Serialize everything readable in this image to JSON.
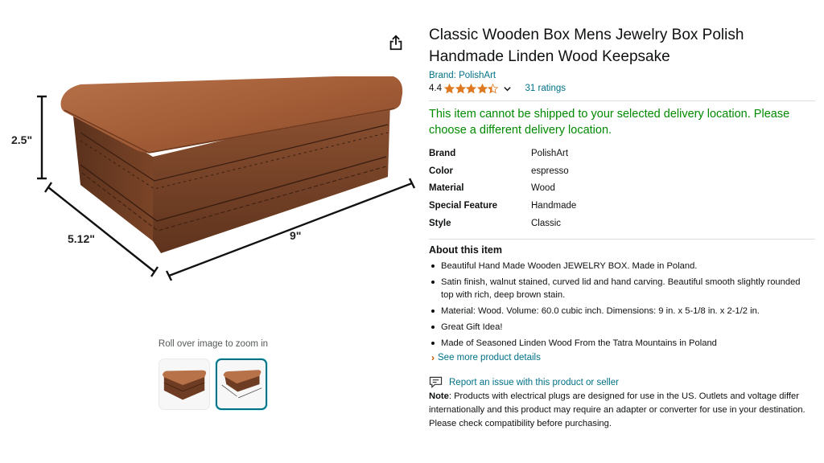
{
  "product": {
    "title": "Classic Wooden Box Mens Jewelry Box Polish Handmade Linden Wood Keepsake",
    "brand_link": "Brand: PolishArt",
    "rating": "4.4",
    "rating_fraction": 0.88,
    "ratings_count": "31 ratings",
    "shipping_message": "This item cannot be shipped to your selected delivery location. Please choose a different delivery location."
  },
  "image": {
    "dim_height": "2.5\"",
    "dim_depth": "5.12\"",
    "dim_width": "9\"",
    "zoom_hint": "Roll over image to zoom in"
  },
  "specs": [
    {
      "label": "Brand",
      "value": "PolishArt"
    },
    {
      "label": "Color",
      "value": "espresso"
    },
    {
      "label": "Material",
      "value": "Wood"
    },
    {
      "label": "Special Feature",
      "value": "Handmade"
    },
    {
      "label": "Style",
      "value": "Classic"
    }
  ],
  "about": {
    "title": "About this item",
    "bullets": [
      "Beautiful Hand Made Wooden JEWELRY BOX. Made in Poland.",
      "Satin finish, walnut stained, curved lid and hand carving. Beautiful smooth slightly rounded top with rich, deep brown stain.",
      "Material: Wood. Volume: 60.0 cubic inch. Dimensions: 9 in. x 5-1/8 in. x 2-1/2 in.",
      "Great Gift Idea!",
      "Made of Seasoned Linden Wood From the Tatra Mountains in Poland"
    ],
    "see_more": "See more product details"
  },
  "report": {
    "link": "Report an issue with this product or seller"
  },
  "note": {
    "label": "Note",
    "text": ": Products with electrical plugs are designed for use in the US. Outlets and voltage differ internationally and this product may require an adapter or converter for use in your destination. Please check compatibility before purchasing."
  },
  "colors": {
    "link": "#007185",
    "success": "#008a00",
    "star": "#de7921",
    "thumb_selected": "#007185"
  },
  "icons": {
    "share": "share-icon",
    "star": "star-icon",
    "chevron": "chevron-down-icon",
    "report": "report-icon"
  }
}
